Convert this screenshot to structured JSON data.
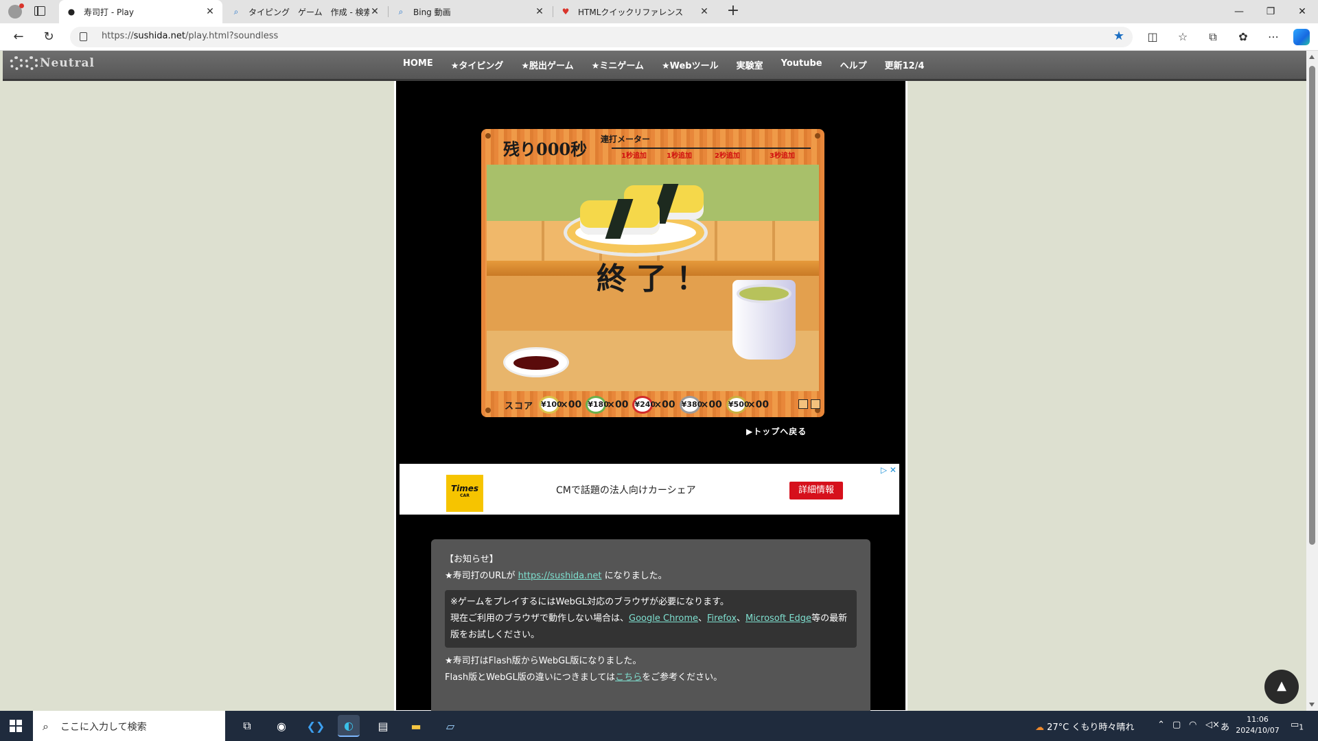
{
  "browser": {
    "tabs": [
      {
        "title": "寿司打 - Play",
        "active": true
      },
      {
        "title": "タイピング　ゲーム　作成 - 検索",
        "active": false
      },
      {
        "title": "Bing 動画",
        "active": false
      },
      {
        "title": "HTMLクイックリファレンス",
        "active": false
      }
    ],
    "url_prefix": "https://",
    "url_host": "sushida.net",
    "url_path": "/play.html?soundless"
  },
  "site": {
    "logo": "Neutral",
    "nav": [
      "HOME",
      "★タイピング",
      "★脱出ゲーム",
      "★ミニゲーム",
      "★Webツール",
      "実験室",
      "Youtube",
      "ヘルプ",
      "更新12/4"
    ]
  },
  "game": {
    "remaining": "残り000秒",
    "meter_title": "連打メーター",
    "meter_bonuses": [
      "1秒追加",
      "1秒追加",
      "2秒追加",
      "3秒追加"
    ],
    "end_text": "終了！",
    "score_label": "スコア",
    "plates": [
      {
        "price": "¥100",
        "count": "×00",
        "color": "#d8c24a"
      },
      {
        "price": "¥180",
        "count": "×00",
        "color": "#6ab04c"
      },
      {
        "price": "¥240",
        "count": "×00",
        "color": "#d12b2b"
      },
      {
        "price": "¥380",
        "count": "×00",
        "color": "#9a9a9a"
      },
      {
        "price": "¥500",
        "count": "×00",
        "color": "#c8b040"
      }
    ],
    "back_to_top": "▶トップへ戻る"
  },
  "ad": {
    "logo": "Times",
    "logo_sub": "CAR",
    "text": "CMで話題の法人向けカーシェア",
    "button": "詳細情報"
  },
  "notice": {
    "heading": "【お知らせ】",
    "line1_pre": "★寿司打のURLが ",
    "line1_link": "https://sushida.net",
    "line1_post": " になりました。",
    "box_line1": "※ゲームをプレイするにはWebGL対応のブラウザが必要になります。",
    "box_line2_pre": "現在ご利用のブラウザで動作しない場合は、",
    "box_link1": "Google Chrome",
    "box_sep1": "、",
    "box_link2": "Firefox",
    "box_sep2": "、",
    "box_link3": "Microsoft Edge",
    "box_line2_post": "等の最新版をお試しください。",
    "line3": "★寿司打はFlash版からWebGL版になりました。",
    "line4_pre": "Flash版とWebGL版の違いにつきましては",
    "line4_link": "こちら",
    "line4_post": "をご参考ください。"
  },
  "taskbar": {
    "search_placeholder": "ここに入力して検索",
    "weather": "27°C  くもり時々晴れ",
    "time": "11:06",
    "date": "2024/10/07",
    "ime": "あ",
    "notifications": "1"
  }
}
